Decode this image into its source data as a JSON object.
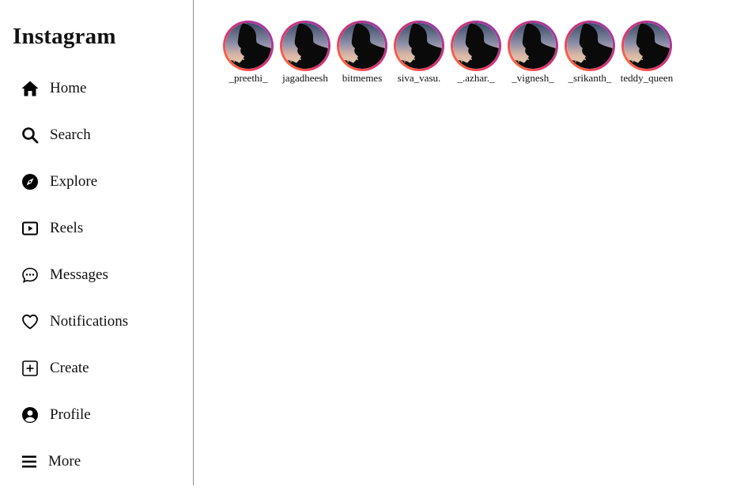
{
  "app": {
    "brand": "Instagram"
  },
  "sidebar": {
    "items": [
      {
        "label": "Home",
        "icon": "home-icon"
      },
      {
        "label": "Search",
        "icon": "search-icon"
      },
      {
        "label": "Explore",
        "icon": "compass-icon"
      },
      {
        "label": "Reels",
        "icon": "reels-icon"
      },
      {
        "label": "Messages",
        "icon": "chat-bubble-icon"
      },
      {
        "label": "Notifications",
        "icon": "heart-icon"
      },
      {
        "label": "Create",
        "icon": "plus-square-icon"
      },
      {
        "label": "Profile",
        "icon": "user-circle-icon"
      },
      {
        "label": "More",
        "icon": "menu-icon"
      }
    ]
  },
  "stories": {
    "users": [
      "_preethi_",
      "jagadheesh",
      "bitmemes",
      "siva_vasu.",
      "_.azhar._",
      "_vignesh_",
      "_srikanth_",
      "teddy_queen"
    ]
  },
  "colors": {
    "ring_start": "#8a3ab9",
    "ring_end": "#f58529",
    "divider": "#8e8e8e"
  }
}
